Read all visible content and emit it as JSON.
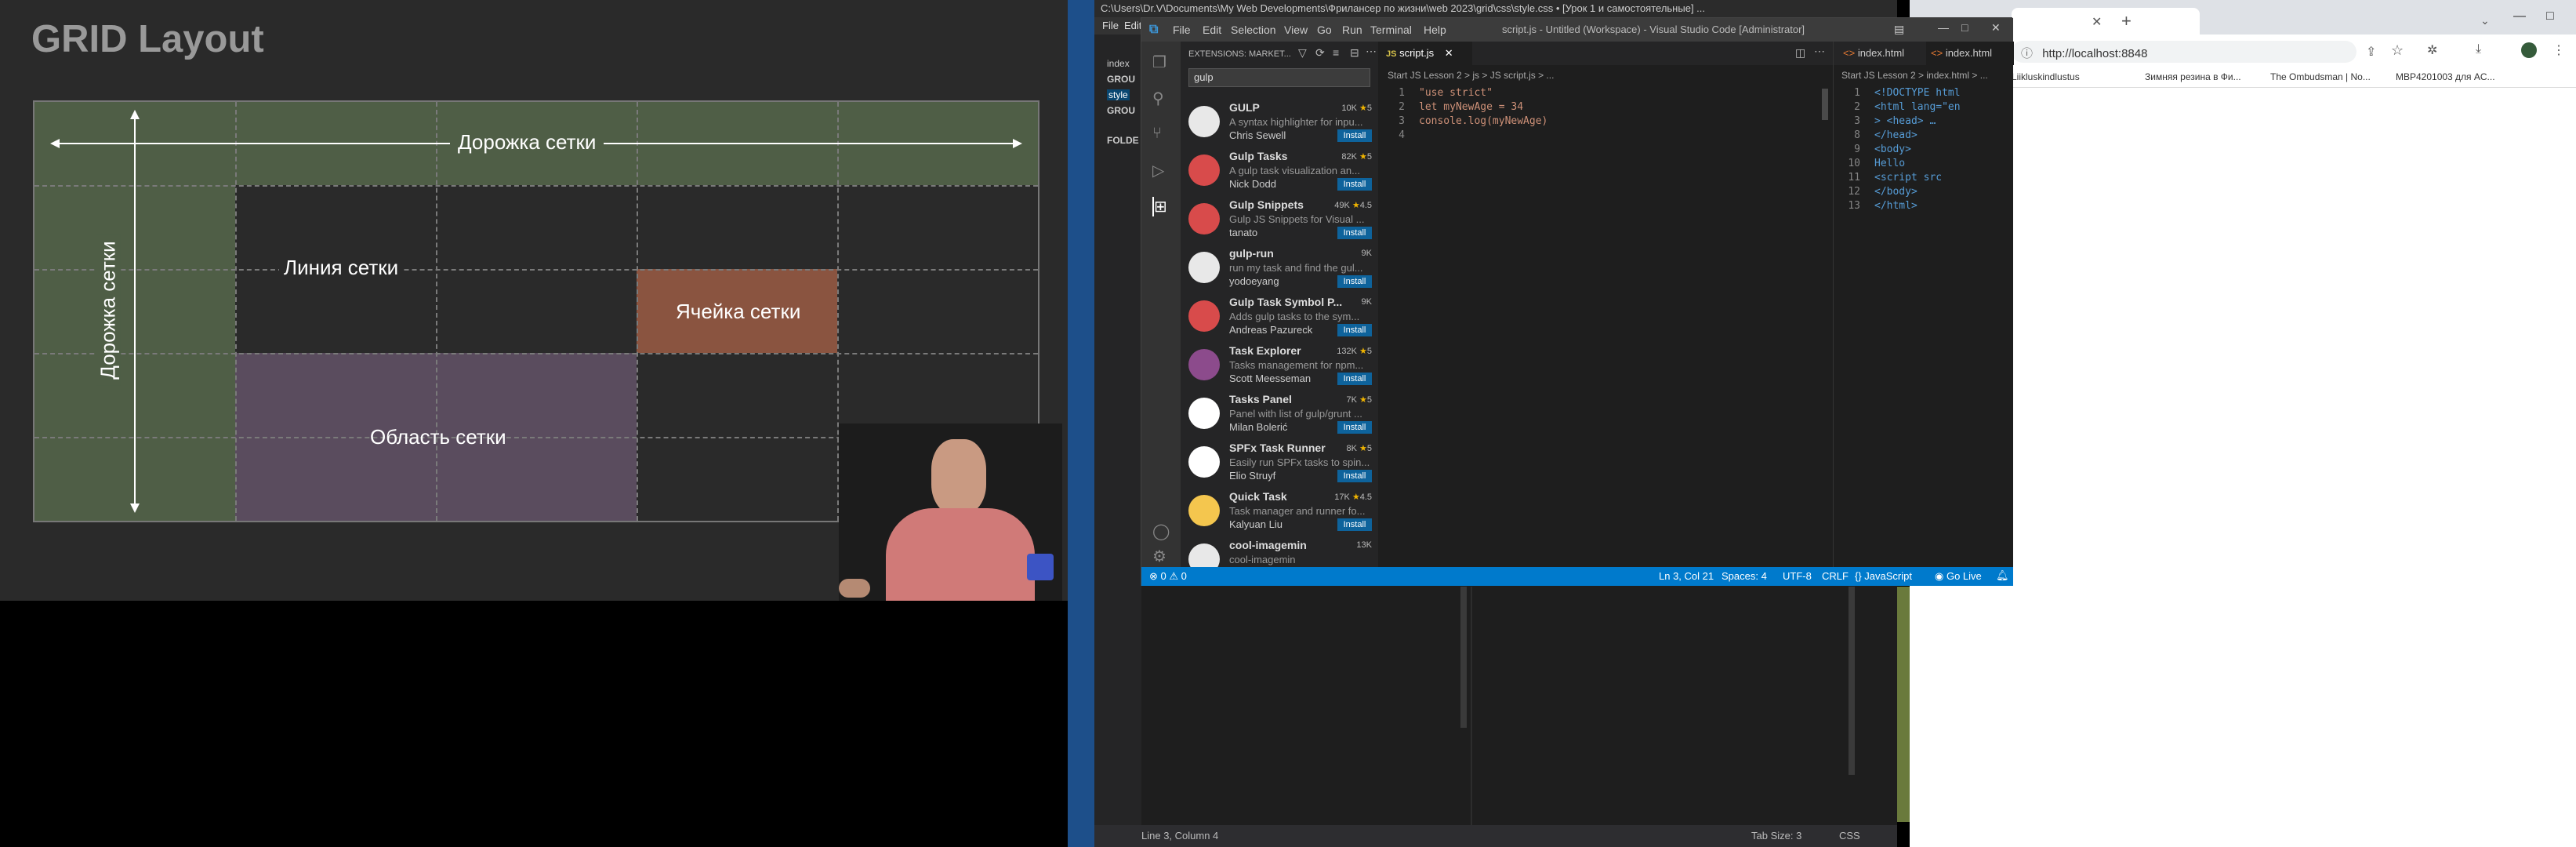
{
  "slide": {
    "title": "GRID Layout",
    "labels": {
      "track_horizontal": "Дорожка сетки",
      "track_vertical": "Дорожка сетки",
      "line": "Линия сетки",
      "cell": "Ячейка сетки",
      "area": "Область сетки"
    },
    "colors": {
      "track": "#4f5e46",
      "cell": "#8a5440",
      "area": "#5a4c5e"
    }
  },
  "back_window": {
    "title": "C:\\Users\\Dr.V\\Documents\\My Web Developments\\Фрилансер по жизни\\web 2023\\grid\\css\\style.css • [Урок 1 и самостоятельные] ...",
    "menu": [
      "File",
      "Edit"
    ],
    "sidebar_items": [
      "index",
      "GROU",
      "style",
      "GROU",
      "FOLDE"
    ],
    "status": {
      "line_col": "Line 3, Column 4",
      "tab_size": "Tab Size: 3",
      "lang": "CSS"
    }
  },
  "vscode": {
    "title": "script.js - Untitled (Workspace) - Visual Studio Code [Administrator]",
    "menu": [
      "File",
      "Edit",
      "Selection",
      "View",
      "Go",
      "Run",
      "Terminal",
      "Help"
    ],
    "extensions_header": "EXTENSIONS: MARKET...",
    "search_value": "gulp",
    "extensions": [
      {
        "name": "GULP",
        "downloads": "10K",
        "rating": "5",
        "desc": "A syntax highlighter for inpu...",
        "author": "Chris Sewell",
        "action": "Install"
      },
      {
        "name": "Gulp Tasks",
        "downloads": "82K",
        "rating": "5",
        "desc": "A gulp task visualization an...",
        "author": "Nick Dodd",
        "action": "Install"
      },
      {
        "name": "Gulp Snippets",
        "downloads": "49K",
        "rating": "4.5",
        "desc": "Gulp JS Snippets for Visual ...",
        "author": "tanato",
        "action": "Install"
      },
      {
        "name": "gulp-run",
        "downloads": "9K",
        "rating": "",
        "desc": "run my task and find the gul...",
        "author": "yodoeyang",
        "action": "Install"
      },
      {
        "name": "Gulp Task Symbol P...",
        "downloads": "9K",
        "rating": "",
        "desc": "Adds gulp tasks to the sym...",
        "author": "Andreas Pazureck",
        "action": "Install"
      },
      {
        "name": "Task Explorer",
        "downloads": "132K",
        "rating": "5",
        "desc": "Tasks management for npm...",
        "author": "Scott Meesseman",
        "action": "Install"
      },
      {
        "name": "Tasks Panel",
        "downloads": "7K",
        "rating": "5",
        "desc": "Panel with list of gulp/grunt ...",
        "author": "Milan Bolerić",
        "action": "Install"
      },
      {
        "name": "SPFx Task Runner",
        "downloads": "8K",
        "rating": "5",
        "desc": "Easily run SPFx tasks to spin...",
        "author": "Elio Struyf",
        "action": "Install"
      },
      {
        "name": "Quick Task",
        "downloads": "17K",
        "rating": "4.5",
        "desc": "Task manager and runner fo...",
        "author": "Kalyuan Liu",
        "action": "Install"
      },
      {
        "name": "cool-imagemin",
        "downloads": "13K",
        "rating": "",
        "desc": "cool-imagemin",
        "author": "",
        "action": ""
      }
    ],
    "editor1": {
      "tab": "script.js",
      "breadcrumb": "Start JS Lesson 2 > js > JS script.js > ...",
      "lines": [
        {
          "n": "1",
          "code": "\"use strict\""
        },
        {
          "n": "2",
          "code": "let myNewAge = 34"
        },
        {
          "n": "3",
          "code": "console.log(myNewAge)"
        },
        {
          "n": "4",
          "code": ""
        }
      ]
    },
    "editor2": {
      "tabs": [
        "index.html",
        "index.html"
      ],
      "breadcrumb": "Start JS Lesson 2 > index.html > ...",
      "lines": [
        {
          "n": "1",
          "code": "<!DOCTYPE html"
        },
        {
          "n": "2",
          "code": "<html lang=\"en"
        },
        {
          "n": "3",
          "code": "> <head> …"
        },
        {
          "n": "8",
          "code": "</head>"
        },
        {
          "n": "9",
          "code": "<body>"
        },
        {
          "n": "10",
          "code": "  Hello"
        },
        {
          "n": "11",
          "code": "  <script src"
        },
        {
          "n": "12",
          "code": "</body>"
        },
        {
          "n": "13",
          "code": "</html>"
        }
      ]
    },
    "status": {
      "problems": "⊗ 0 ⚠ 0",
      "position": "Ln 3, Col 21",
      "spaces": "Spaces: 4",
      "encoding": "UTF-8",
      "eol": "CRLF",
      "language": "{} JavaScript",
      "golive": "Go Live"
    }
  },
  "browser": {
    "url": "http://localhost:8848",
    "bookmarks": [
      "Liikluskindlustus",
      "Зимняя резина в Фи...",
      "The Ombudsman | No...",
      "MBP4201003 для AC..."
    ]
  }
}
